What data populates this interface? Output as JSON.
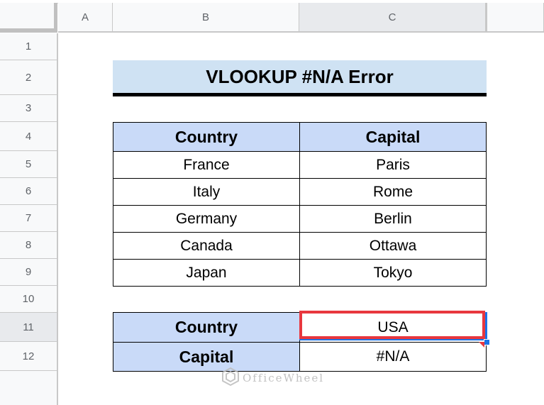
{
  "spreadsheet": {
    "columns": [
      "A",
      "B",
      "C"
    ],
    "rows": [
      "1",
      "2",
      "3",
      "4",
      "5",
      "6",
      "7",
      "8",
      "9",
      "10",
      "11",
      "12"
    ],
    "selected_row": "11",
    "selected_column": "C",
    "selected_cell": "C11"
  },
  "title": "VLOOKUP #N/A Error",
  "lookup_table": {
    "headers": [
      "Country",
      "Capital"
    ],
    "rows": [
      [
        "France",
        "Paris"
      ],
      [
        "Italy",
        "Rome"
      ],
      [
        "Germany",
        "Berlin"
      ],
      [
        "Canada",
        "Ottawa"
      ],
      [
        "Japan",
        "Tokyo"
      ]
    ]
  },
  "result_table": {
    "rows": [
      {
        "label": "Country",
        "value": "USA"
      },
      {
        "label": "Capital",
        "value": "#N/A"
      }
    ]
  },
  "colors": {
    "title_fill": "#cfe2f3",
    "header_fill": "#c9daf8",
    "highlight_border": "#e8373e",
    "selection": "#1a73e8"
  },
  "watermark": "OfficeWheel"
}
